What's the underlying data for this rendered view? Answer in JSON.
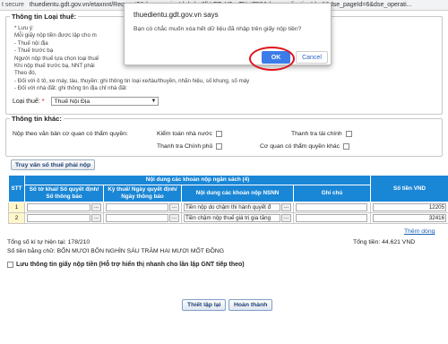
{
  "browser": {
    "security_label": "t secure",
    "url": "thuedientu.gdt.gov.vn/etaxnnt/Request?&dse_sessionId=lmla-6lbLEFgV2yxTNntF59&dse_applicationId=-1&dse_pageId=6&dse_operati..."
  },
  "section_loai_thue": {
    "legend": "Thông tin Loại thuế:",
    "notes": [
      "* Lưu ý:",
      "  Mỗi giấy nộp tiền được lập cho m",
      "  - Thuế nội địa",
      "  - Thuế trước bạ",
      "  Người nộp thuế lựa chọn loại thuế",
      "  Khi nộp thuế trước bạ, NNT phải",
      "  Theo đó,",
      "  - Đối với ô tô, xe máy, tàu, thuyền: ghi thông tin loại xe/tàu/thuyền, nhãn hiệu, số khung, số máy",
      "  - Đối với nhà đất: ghi thông tin địa chỉ nhà đất"
    ],
    "label": "Loại thuế:",
    "required_mark": "*",
    "selected": "Thuế Nội Địa",
    "arrow": "▼"
  },
  "section_khac": {
    "legend": "Thông tin khác:",
    "row1_label": "Nộp theo văn bản cơ quan có thẩm quyền:",
    "kiem_toan": "Kiểm toán nhà nước",
    "thanh_tra_tc": "Thanh tra tài chính",
    "thanh_tra_cp": "Thanh tra Chính phủ",
    "co_quan_khac": "Cơ quan có thẩm quyền khác"
  },
  "btn_truy_van": "Truy vấn số thuế phải nộp",
  "table": {
    "h_stt": "STT",
    "h_group": "Nội dung các khoản nộp ngân sách (4)",
    "h_so_to_khai": "Số tờ khai/ Số quyết định/ Số thông báo",
    "h_ky_thue": "Kỳ thuế/ Ngày quyết định/ Ngày thông báo",
    "h_noi_dung": "Nội dung các khoản nộp NSNN",
    "h_ghi_chu": "Ghi chú",
    "h_so_tien": "Số tiền VND",
    "dots": "...",
    "rows": [
      {
        "stt": "1",
        "noi_dung": "Tiền nộp do chậm thi hành quyết đ",
        "so_tien": "12205"
      },
      {
        "stt": "2",
        "noi_dung": "Tiền chậm nộp thuế giá trị gia tăng",
        "so_tien": "32416"
      }
    ]
  },
  "link_them_dong": "Thêm dòng",
  "summary": {
    "tong_ky_tu": "Tổng số kí tự hiện tại: 178/210",
    "bang_chu": "Số tiền bằng chữ: BỐN MƯƠI BỐN NGHÌN SÁU TRĂM HAI MƯƠI MỐT ĐỒNG",
    "tong_tien": "Tổng tiền: 44.621 VND"
  },
  "luu_label": "Lưu thông tin giấy nộp tiền (Hỗ trợ hiển thị nhanh cho lần lập GNT tiếp theo)",
  "btn_thiet_lap_lai": "Thiết lập lại",
  "btn_hoan_thanh": "Hoàn thành",
  "dialog": {
    "title": "thuedientu.gdt.gov.vn says",
    "message": "Bạn có chắc muốn xóa hết dữ liệu đã nhập trên giấy nộp tiền?",
    "ok": "OK",
    "cancel": "Cancel"
  },
  "colors": {
    "table_header": "#1a86d6",
    "ok_button": "#3b7ce9",
    "highlight_ring": "#e0141b"
  }
}
